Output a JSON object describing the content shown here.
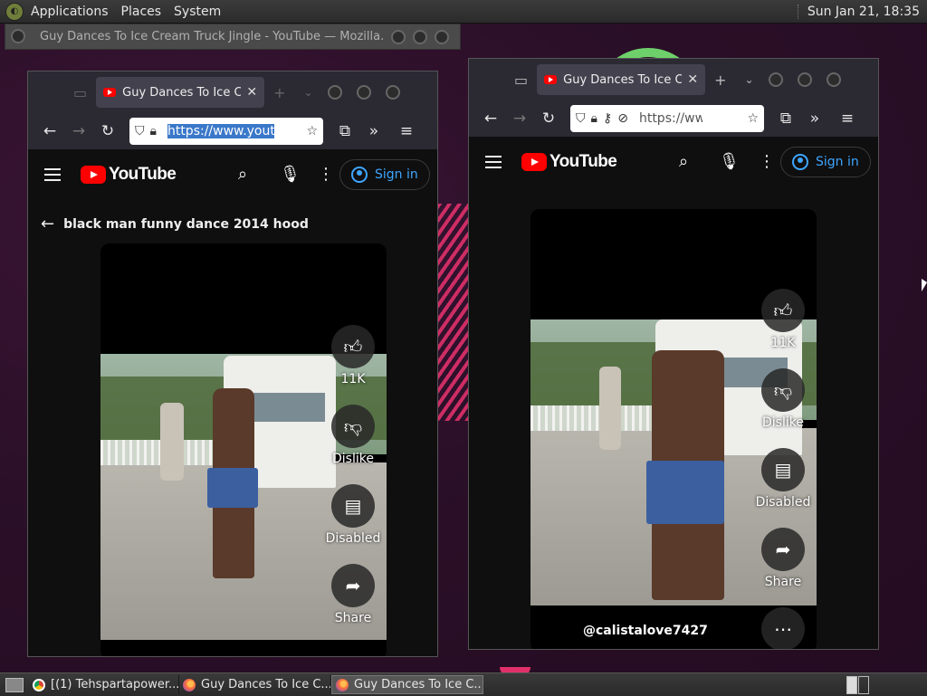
{
  "top_panel": {
    "menus": [
      "Applications",
      "Places",
      "System"
    ],
    "clock": "Sun Jan 21, 18:35"
  },
  "background_window": {
    "title": "Guy Dances To Ice Cream Truck Jingle - YouTube — Mozilla..."
  },
  "left_window": {
    "tab_title": "Guy Dances To Ice Cream Truck Jingle",
    "url": "https://www.youtube.com/",
    "youtube": {
      "logo_text": "YouTube",
      "sign_in": "Sign in",
      "back_title": "black man funny dance 2014 hood",
      "actions": {
        "likes": "11K",
        "dislike": "Dislike",
        "comments": "Disabled",
        "share": "Share"
      }
    }
  },
  "right_window": {
    "tab_title": "Guy Dances To Ice Cream Truck Jingle",
    "url": "https://www.youtube.com/",
    "youtube": {
      "logo_text": "YouTube",
      "sign_in": "Sign in",
      "handle": "@calistalove7427",
      "actions": {
        "likes": "11K",
        "dislike": "Dislike",
        "comments": "Disabled",
        "share": "Share"
      }
    }
  },
  "taskbar": {
    "tasks": [
      {
        "label": "[(1) Tehspartapower...",
        "icon": "chrome-icon"
      },
      {
        "label": "Guy Dances To Ice C...",
        "icon": "firefox-icon"
      },
      {
        "label": "Guy Dances To Ice C...",
        "icon": "firefox-icon"
      }
    ]
  },
  "colors": {
    "youtube_red": "#ff0000",
    "sign_in_blue": "#3ea6ff",
    "desktop_bg": "#2b0f28"
  }
}
